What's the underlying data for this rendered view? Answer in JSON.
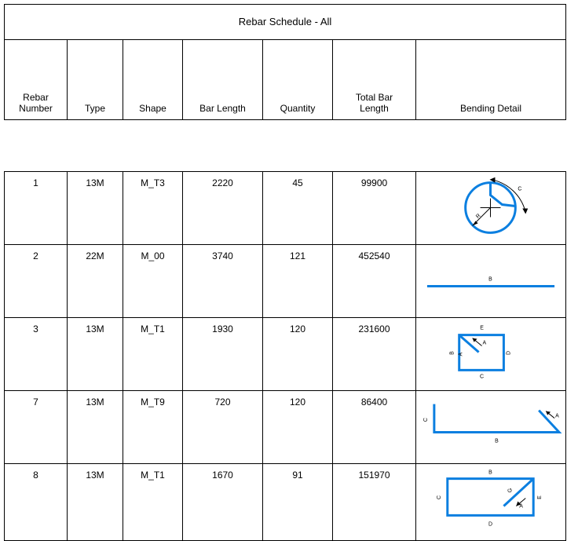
{
  "title": "Rebar Schedule - All",
  "columns": [
    {
      "key": "rebar_number",
      "label": "Rebar\nNumber"
    },
    {
      "key": "type",
      "label": "Type"
    },
    {
      "key": "shape",
      "label": "Shape"
    },
    {
      "key": "bar_length",
      "label": "Bar Length"
    },
    {
      "key": "quantity",
      "label": "Quantity"
    },
    {
      "key": "total_bar_length",
      "label": "Total Bar\nLength"
    },
    {
      "key": "bending_detail",
      "label": "Bending Detail"
    }
  ],
  "column_labels": {
    "rebar_number_line1": "Rebar",
    "rebar_number_line2": "Number",
    "type": "Type",
    "shape": "Shape",
    "bar_length": "Bar Length",
    "quantity": "Quantity",
    "total_bar_length_line1": "Total Bar",
    "total_bar_length_line2": "Length",
    "bending_detail": "Bending Detail"
  },
  "rows": [
    {
      "rebar_number": "1",
      "type": "13M",
      "shape": "M_T3",
      "bar_length": "2220",
      "quantity": "45",
      "total_bar_length": "99900",
      "bending_detail": {
        "shape_kind": "circle-stirrup",
        "dimension_labels": [
          "R",
          "C"
        ]
      }
    },
    {
      "rebar_number": "2",
      "type": "22M",
      "shape": "M_00",
      "bar_length": "3740",
      "quantity": "121",
      "total_bar_length": "452540",
      "bending_detail": {
        "shape_kind": "straight-bar",
        "dimension_labels": [
          "B"
        ]
      }
    },
    {
      "rebar_number": "3",
      "type": "13M",
      "shape": "M_T1",
      "bar_length": "1930",
      "quantity": "120",
      "total_bar_length": "231600",
      "bending_detail": {
        "shape_kind": "closed-rect-stirrup-hook-topleft",
        "dimension_labels": [
          "A",
          "B",
          "C",
          "D",
          "E"
        ]
      }
    },
    {
      "rebar_number": "7",
      "type": "13M",
      "shape": "M_T9",
      "bar_length": "720",
      "quantity": "120",
      "total_bar_length": "86400",
      "bending_detail": {
        "shape_kind": "open-bar-leg-and-diagonal",
        "dimension_labels": [
          "A",
          "B",
          "C"
        ]
      }
    },
    {
      "rebar_number": "8",
      "type": "13M",
      "shape": "M_T1",
      "bar_length": "1670",
      "quantity": "91",
      "total_bar_length": "151970",
      "bending_detail": {
        "shape_kind": "closed-rect-stirrup-hook-topright",
        "dimension_labels": [
          "A",
          "B",
          "C",
          "D",
          "E",
          "G"
        ]
      }
    }
  ],
  "colors": {
    "bend_line": "#0b7fe0",
    "border": "#000000",
    "text": "#000000",
    "background": "#ffffff"
  }
}
